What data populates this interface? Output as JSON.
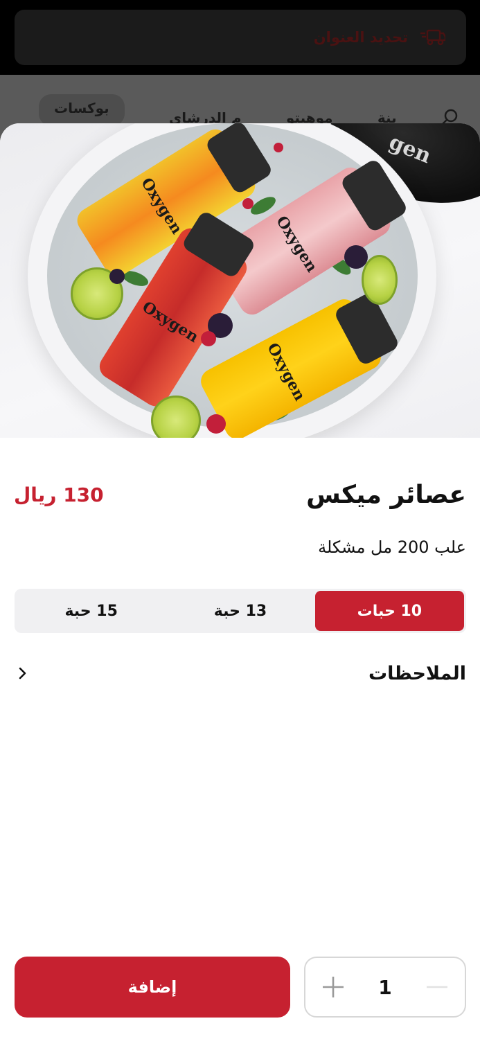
{
  "background": {
    "address_label": "تحديد العنوان",
    "nav_items": [
      "بوكسات",
      "م الدرشاي",
      "موهيتو",
      "بنة"
    ]
  },
  "image_overlay": {
    "lid_text": "gen",
    "bottle_label": "Oxygen"
  },
  "product": {
    "title": "عصائر ميكس",
    "price": "130 ريال",
    "description": "علب 200 مل مشكلة"
  },
  "size_options": [
    {
      "label": "10 حبات",
      "selected": true
    },
    {
      "label": "13 حبة",
      "selected": false
    },
    {
      "label": "15 حبة",
      "selected": false
    }
  ],
  "notes": {
    "label": "الملاحظات"
  },
  "cart": {
    "add_label": "إضافة",
    "quantity": "1"
  },
  "colors": {
    "accent": "#c62130",
    "segment_bg": "#f0f0f2",
    "text": "#111111"
  },
  "icons": [
    "truck-icon",
    "search-icon",
    "chevron-right-icon",
    "plus-icon",
    "minus-icon"
  ]
}
